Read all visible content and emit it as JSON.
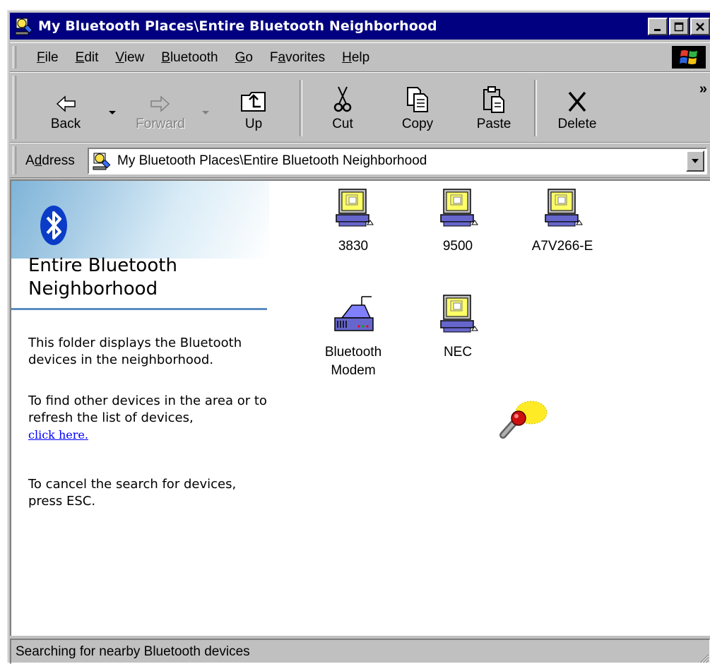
{
  "window": {
    "title": "My Bluetooth Places\\Entire Bluetooth Neighborhood",
    "controls": [
      "minimize",
      "maximize",
      "close"
    ]
  },
  "menubar": {
    "items": [
      {
        "label": "File",
        "accel": "F"
      },
      {
        "label": "Edit",
        "accel": "E"
      },
      {
        "label": "View",
        "accel": "V"
      },
      {
        "label": "Bluetooth",
        "accel": "B"
      },
      {
        "label": "Go",
        "accel": "G"
      },
      {
        "label": "Favorites",
        "accel": "a"
      },
      {
        "label": "Help",
        "accel": "H"
      }
    ]
  },
  "toolbar": {
    "back": "Back",
    "forward": "Forward",
    "up": "Up",
    "cut": "Cut",
    "copy": "Copy",
    "paste": "Paste",
    "delete": "Delete",
    "more": "»"
  },
  "address": {
    "label": "Address",
    "value": "My Bluetooth Places\\Entire Bluetooth Neighborhood"
  },
  "sidebar": {
    "title": "Entire Bluetooth Neighborhood",
    "paragraph1": "This folder displays the Bluetooth devices in the neighborhood.",
    "paragraph2": "To find other devices in the area or to refresh the list of devices,",
    "link": "click here.",
    "paragraph3": "To cancel the search for devices, press ESC."
  },
  "devices": [
    {
      "label": "3830",
      "icon": "computer-icon"
    },
    {
      "label": "9500",
      "icon": "computer-icon"
    },
    {
      "label": "A7V266-E",
      "icon": "computer-icon"
    },
    {
      "label": "Bluetooth Modem",
      "icon": "modem-icon"
    },
    {
      "label": "NEC",
      "icon": "computer-icon"
    }
  ],
  "status": {
    "text": "Searching for nearby Bluetooth devices"
  },
  "colors": {
    "titlebar": "#000080",
    "chrome": "#c0c0c0",
    "link": "#0000ff",
    "sidebar_rule": "#5a8ec0"
  }
}
